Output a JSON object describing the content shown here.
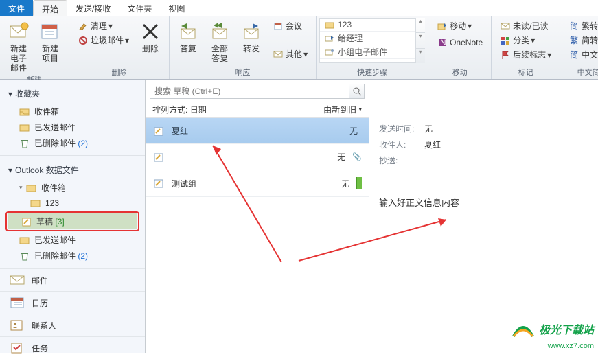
{
  "tabs": {
    "file": "文件",
    "home": "开始",
    "sendrecv": "发送/接收",
    "folder": "文件夹",
    "view": "视图"
  },
  "ribbon": {
    "new": {
      "new_mail": "新建\n电子邮件",
      "new_item": "新建项目",
      "group": "新建"
    },
    "delete": {
      "clean": "清理",
      "junk": "垃圾邮件",
      "delete": "删除",
      "group": "删除"
    },
    "respond": {
      "reply": "答复",
      "replyall": "全部答复",
      "forward": "转发",
      "meeting": "会议",
      "other": "其他",
      "group": "响应"
    },
    "qs": {
      "a": "123",
      "b": "给经理",
      "c": "小组电子邮件",
      "group": "快速步骤"
    },
    "move": {
      "move": "移动",
      "onenote": "OneNote",
      "group": "移动"
    },
    "tags": {
      "unread": "未读/已读",
      "category": "分类",
      "followup": "后续标志",
      "group": "标记"
    },
    "lang": {
      "a": "繁转简",
      "b": "简转繁",
      "c": "中文简繁转换",
      "group": "中文简繁转换"
    }
  },
  "nav": {
    "favorites": "收藏夹",
    "inbox": "收件箱",
    "sent": "已发送邮件",
    "deleted": "已删除邮件",
    "deleted_count": "(2)",
    "datafile": "Outlook 数据文件",
    "sub123": "123",
    "drafts": "草稿",
    "drafts_count": "[3]",
    "bottom": {
      "mail": "邮件",
      "calendar": "日历",
      "contacts": "联系人",
      "tasks": "任务"
    }
  },
  "list": {
    "search_placeholder": "搜索 草稿 (Ctrl+E)",
    "sort_label": "排列方式:",
    "sort_field": "日期",
    "sort_order": "由新到旧",
    "items": [
      {
        "name": "夏红",
        "date": "无"
      },
      {
        "name": "",
        "date": "无"
      },
      {
        "name": "测试组",
        "date": "无"
      }
    ]
  },
  "reading": {
    "fields": {
      "sent_label": "发送时间:",
      "sent_val": "无",
      "to_label": "收件人:",
      "to_val": "夏红",
      "cc_label": "抄送:"
    },
    "body": "输入好正文信息内容"
  },
  "watermark": {
    "line1": "极光下载站",
    "line2": "www.xz7.com"
  }
}
